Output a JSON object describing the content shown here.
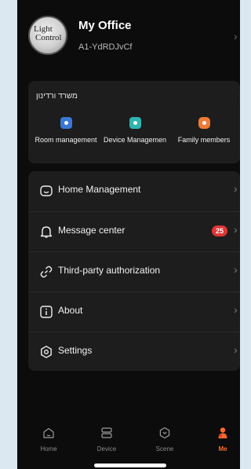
{
  "profile": {
    "avatar_line1": "Light",
    "avatar_line2": "Control",
    "name": "My Office",
    "home_id": "A1-YdRDJvCf"
  },
  "home_card": {
    "title": "משרד ורדינון",
    "actions": [
      {
        "label": "Room management",
        "icon": "room-icon",
        "color": "#3a78d6"
      },
      {
        "label": "Device Managemen",
        "icon": "device-icon",
        "color": "#2eb5b0"
      },
      {
        "label": "Family members",
        "icon": "family-icon",
        "color": "#f07a36"
      }
    ]
  },
  "menu": [
    {
      "label": "Home Management",
      "icon": "home-management-icon"
    },
    {
      "label": "Message center",
      "icon": "bell-icon",
      "badge": "25"
    },
    {
      "label": "Third-party authorization",
      "icon": "link-icon"
    },
    {
      "label": "About",
      "icon": "info-icon"
    },
    {
      "label": "Settings",
      "icon": "settings-icon"
    }
  ],
  "tabs": [
    {
      "label": "Home",
      "icon": "home-icon"
    },
    {
      "label": "Device",
      "icon": "device-tab-icon"
    },
    {
      "label": "Scene",
      "icon": "scene-icon"
    },
    {
      "label": "Me",
      "icon": "me-icon",
      "active": true
    }
  ],
  "colors": {
    "accent": "#ff6a2c",
    "badge": "#e03535"
  }
}
